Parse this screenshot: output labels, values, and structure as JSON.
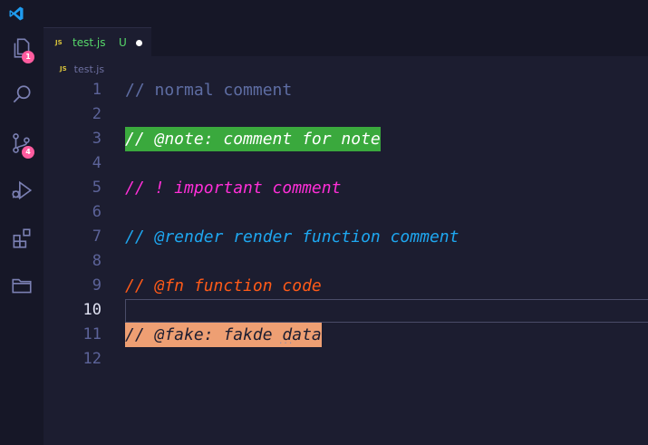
{
  "editor_tab": {
    "filename": "test.js",
    "git_status": "U",
    "file_icon_text": "JS"
  },
  "breadcrumb": {
    "file_icon_text": "JS",
    "filename": "test.js"
  },
  "activity_bar": {
    "explorer_badge": "1",
    "source_control_badge": "4"
  },
  "lines": [
    {
      "number": "1",
      "text": "// normal comment"
    },
    {
      "number": "2",
      "text": ""
    },
    {
      "number": "3",
      "text": "// @note: comment for note"
    },
    {
      "number": "4",
      "text": ""
    },
    {
      "number": "5",
      "text": "// ! important comment"
    },
    {
      "number": "6",
      "text": ""
    },
    {
      "number": "7",
      "text": "// @render render function comment"
    },
    {
      "number": "8",
      "text": ""
    },
    {
      "number": "9",
      "text": "// @fn function code"
    },
    {
      "number": "10",
      "text": ""
    },
    {
      "number": "11",
      "text": "// @fake: fakde data"
    },
    {
      "number": "12",
      "text": ""
    }
  ],
  "hover_hint": "...",
  "colors": {
    "note_highlight": "#3aa93d",
    "important": "#ff2fd8",
    "render": "#1ea7f0",
    "fn": "#ff5a18",
    "fake_highlight": "#ee9f73",
    "badge": "#ff5c9f",
    "untracked": "#57d96a"
  }
}
